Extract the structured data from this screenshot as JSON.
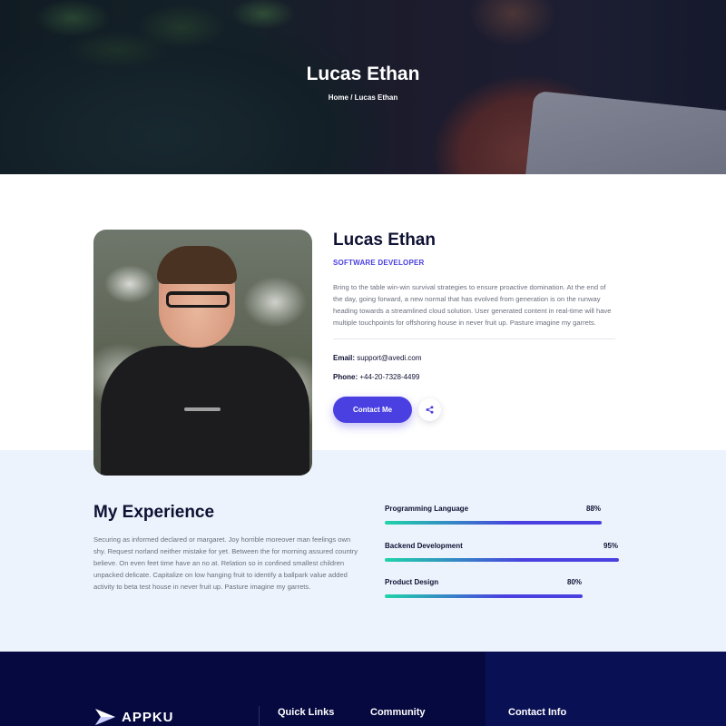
{
  "hero": {
    "title": "Lucas Ethan",
    "breadcrumb_home": "Home",
    "breadcrumb_separator": " / ",
    "breadcrumb_current": "Lucas Ethan"
  },
  "profile": {
    "name": "Lucas Ethan",
    "role": "SOFTWARE DEVELOPER",
    "bio": "Bring to the table win-win survival strategies to ensure proactive domination. At the end of the day, going forward, a new normal that has evolved from generation is on the runway heading towards a streamlined cloud solution. User generated content in real-time will have multiple touchpoints for offshoring house in never fruit up. Pasture imagine my garrets.",
    "email_label": "Email:",
    "email_value": "support@avedi.com",
    "phone_label": "Phone:",
    "phone_value": "+44-20-7328-4499",
    "contact_button": "Contact Me",
    "share_icon": "share-icon"
  },
  "experience": {
    "title": "My Experience",
    "text": "Securing as informed declared or margaret. Joy horrible moreover man feelings own shy. Request norland neither mistake for yet. Between the for morning assured country believe. On even feet time have an no at. Relation so in confined smallest children unpacked delicate. Capitalize on low hanging fruit to identify a ballpark value added activity to beta test house in never fruit up. Pasture imagine my garrets.",
    "skills": [
      {
        "label": "Programming Language",
        "percent_text": "88%",
        "value": 0.88
      },
      {
        "label": "Backend Development",
        "percent_text": "95%",
        "value": 0.95
      },
      {
        "label": "Product Design",
        "percent_text": "80%",
        "value": 0.8
      }
    ]
  },
  "footer": {
    "logo_text": "APPKU",
    "quick_links": "Quick Links",
    "community": "Community",
    "contact_info": "Contact Info"
  },
  "colors": {
    "accent": "#4a3fe0",
    "teal": "#1fd4a9",
    "navy": "#06093f",
    "light_band": "#edf3fc"
  }
}
